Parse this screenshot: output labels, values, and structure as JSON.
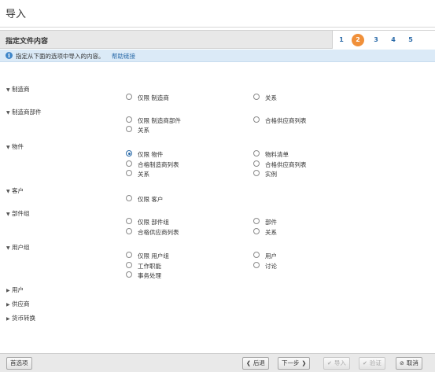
{
  "window": {
    "title": "导入"
  },
  "stepbar": {
    "title": "指定文件内容",
    "steps": [
      {
        "label": "1",
        "active": false
      },
      {
        "label": "2",
        "active": true
      },
      {
        "label": "3",
        "active": false
      },
      {
        "label": "4",
        "active": false
      },
      {
        "label": "5",
        "active": false
      }
    ]
  },
  "info": {
    "icon": "info-icon",
    "text": "指定从下面的选项中导入的内容。",
    "link": "帮助链接"
  },
  "groups": {
    "manufacturer": {
      "label": "制造商",
      "expanded": true,
      "options": {
        "only": "仅限 制造商",
        "relations": "关系"
      }
    },
    "manufacturer_part": {
      "label": "制造商部件",
      "expanded": true,
      "options": {
        "only": "仅限 制造商部件",
        "avl": "合格供应商列表",
        "relations": "关系"
      }
    },
    "item": {
      "label": "物件",
      "expanded": true,
      "selected": "only",
      "options": {
        "only": "仅限 物件",
        "bom": "物料清单",
        "aml": "合格制造商列表",
        "avl": "合格供应商列表",
        "relations": "关系",
        "instances": "实例"
      }
    },
    "customer": {
      "label": "客户",
      "expanded": true,
      "options": {
        "only": "仅限 客户"
      }
    },
    "part_group": {
      "label": "部件组",
      "expanded": true,
      "options": {
        "only": "仅限 部件组",
        "parts": "部件",
        "avl": "合格供应商列表",
        "relations": "关系"
      }
    },
    "user_group": {
      "label": "用户组",
      "expanded": true,
      "options": {
        "only": "仅限 用户组",
        "users": "用户",
        "job_function": "工作职能",
        "discussion": "讨论",
        "transactions": "事务处理"
      }
    },
    "user": {
      "label": "用户",
      "expanded": false
    },
    "supplier": {
      "label": "供应商",
      "expanded": false
    },
    "currency": {
      "label": "货币转换",
      "expanded": false
    }
  },
  "footer": {
    "preferences": "首选项",
    "back": "后退",
    "next": "下一步",
    "import": "导入",
    "validate": "验证",
    "cancel": "取消"
  }
}
